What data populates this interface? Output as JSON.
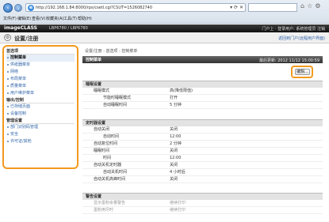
{
  "browser": {
    "url": "http://192.168.1.84:8000/rps/csetl.cgi?CSUT=1526082740",
    "menu": [
      "文件(F)",
      "编辑(E)",
      "查看(V)",
      "收藏夹(A)",
      "工具(T)",
      "帮助(H)"
    ]
  },
  "header": {
    "brand": "imageCLASS",
    "model": "LBP6780 / LBP6780",
    "user_info": "门户上 · 登录用户: 系统管理员 注销",
    "title": "设置/注册",
    "portal_link": "返回到门户(远程用户界面)"
  },
  "sidebar": {
    "sections": [
      {
        "heading": "首选项",
        "items": [
          {
            "label": "控制菜单",
            "active": true
          },
          {
            "label": "供纸器菜单",
            "active": false
          },
          {
            "label": "网络",
            "active": false
          },
          {
            "label": "布局菜单",
            "active": false
          },
          {
            "label": "质量菜单",
            "active": false
          },
          {
            "label": "用户维护菜单",
            "active": false
          }
        ]
      },
      {
        "heading": "输出/控制",
        "items": [
          {
            "label": "已存储页面",
            "active": false
          },
          {
            "label": "设备控制",
            "active": false
          }
        ]
      },
      {
        "heading": "管理设置",
        "items": [
          {
            "label": "部门识别码管理",
            "active": false
          },
          {
            "label": "安全",
            "active": false
          },
          {
            "label": "许可证/其他",
            "active": false
          }
        ]
      }
    ]
  },
  "main": {
    "breadcrumb": "设置/注册 : 首选项 : 控制菜单",
    "panel_title": "控制菜单",
    "last_updated": "最后更新: 2012 11/12 15:00:59",
    "edit_label": "编辑...",
    "sections": [
      {
        "heading": "睡眠设置",
        "rows": [
          {
            "label": "睡眠模式",
            "value": "高(降低限值)",
            "indent": false
          },
          {
            "label": "节能时睡眠模式",
            "value": "打开",
            "indent": true
          },
          {
            "label": "自动睡眠时间",
            "value": "5 分钟",
            "indent": true
          }
        ]
      },
      {
        "heading": "定时器设置",
        "rows": [
          {
            "label": "自动关闭",
            "value": "关闭",
            "indent": false
          },
          {
            "label": "自动时间",
            "value": "12:00",
            "indent": true
          },
          {
            "label": "自动复位时间",
            "value": "2 分钟",
            "indent": false
          },
          {
            "label": "睡眠时间",
            "value": "关闭",
            "indent": false
          },
          {
            "label": "时间",
            "value": "12:00",
            "indent": true
          },
          {
            "label": "自动关机定时器",
            "value": "关闭",
            "indent": false
          },
          {
            "label": "自动关机时间",
            "value": "4 小时后",
            "indent": true
          },
          {
            "label": "自动关机高峰时间",
            "value": "关闭",
            "indent": false
          }
        ]
      },
      {
        "heading": "警告设置",
        "rows": [
          {
            "label": "显示墨粉余量警告",
            "value": "继续打印",
            "indent": false,
            "muted": true
          },
          {
            "label": "墨粉用尽时",
            "value": "继续打印",
            "indent": false,
            "muted": true
          }
        ]
      }
    ]
  }
}
